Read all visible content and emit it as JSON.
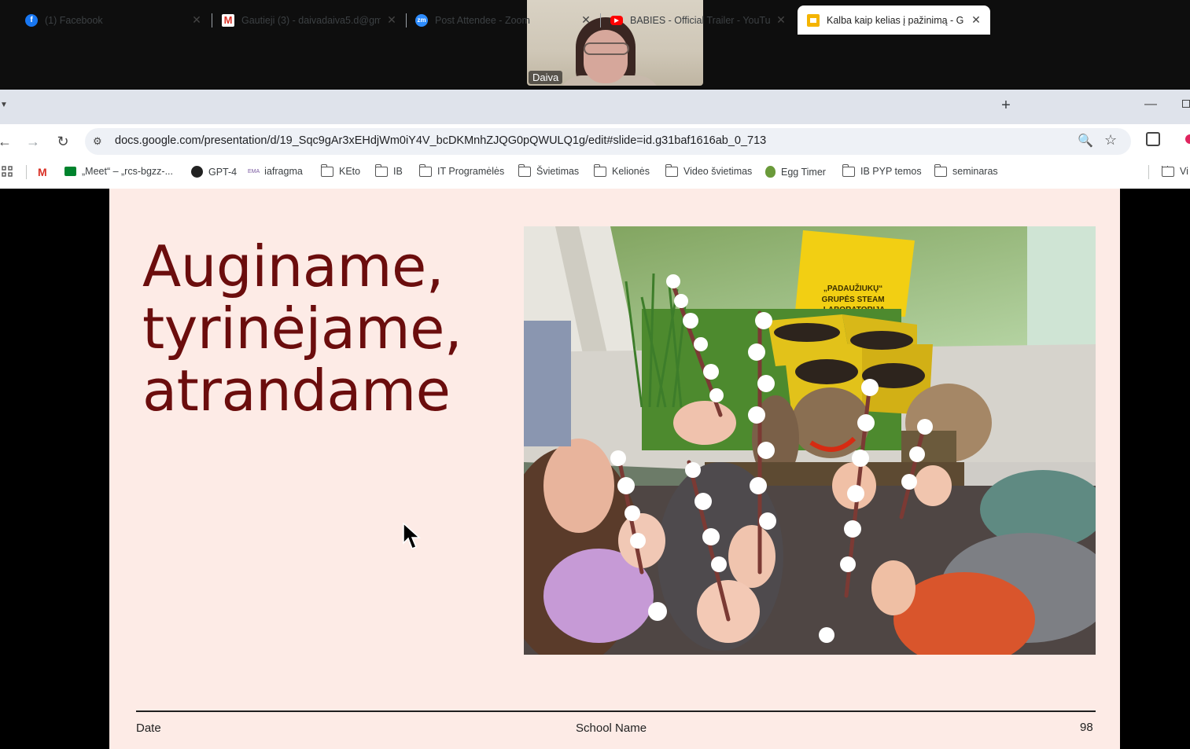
{
  "zoom": {
    "participant_name": "Daiva"
  },
  "browser": {
    "tabs": [
      {
        "title": "(1) Facebook",
        "icon": "facebook-icon",
        "active": false
      },
      {
        "title": "Gautieji (3) - daivadaiva5.d@gm",
        "icon": "gmail-icon",
        "active": false
      },
      {
        "title": "Post Attendee - Zoom",
        "icon": "zoom-icon",
        "active": false
      },
      {
        "title": "BABIES - Official Trailer - YouTu",
        "icon": "youtube-icon",
        "active": false
      },
      {
        "title": "Kalba kaip kelias į pažinimą - G",
        "icon": "slides-icon",
        "active": true
      }
    ],
    "url": "docs.google.com/presentation/d/19_Sqc9gAr3xEHdjWm0iY4V_bcDKMnhZJQG0pQWULQ1g/edit#slide=id.g31baf1616ab_0_713",
    "bookmarks": [
      {
        "label": "",
        "icon": "gmail-icon"
      },
      {
        "label": "„Meet“ – „rcs-bgzz-...",
        "icon": "meet-icon"
      },
      {
        "label": "GPT-4",
        "icon": "openai-icon"
      },
      {
        "label": "iafragma",
        "icon": "site-icon"
      },
      {
        "label": "KEto",
        "icon": "folder-icon"
      },
      {
        "label": "IB",
        "icon": "folder-icon"
      },
      {
        "label": "IT Programėlės",
        "icon": "folder-icon"
      },
      {
        "label": "Švietimas",
        "icon": "folder-icon"
      },
      {
        "label": "Kelionės",
        "icon": "folder-icon"
      },
      {
        "label": "Video švietimas",
        "icon": "folder-icon"
      },
      {
        "label": "Egg Timer",
        "icon": "egg-timer-icon"
      },
      {
        "label": "IB PYP temos",
        "icon": "folder-icon"
      },
      {
        "label": "seminaras",
        "icon": "folder-icon"
      },
      {
        "label": "Vi",
        "icon": "folder-icon"
      }
    ]
  },
  "slide": {
    "title": "Auginame,\ntyrinėjame,\natrandame",
    "photo_sign": "„PADAUŽIUKŲ“\nGRUPĖS STEAM\nLABORATORIJA",
    "footer_left": "Date",
    "footer_center": "School Name",
    "footer_right": "98"
  },
  "colors": {
    "slide_background": "#fdebe6",
    "title_color": "#6b0d0d"
  }
}
